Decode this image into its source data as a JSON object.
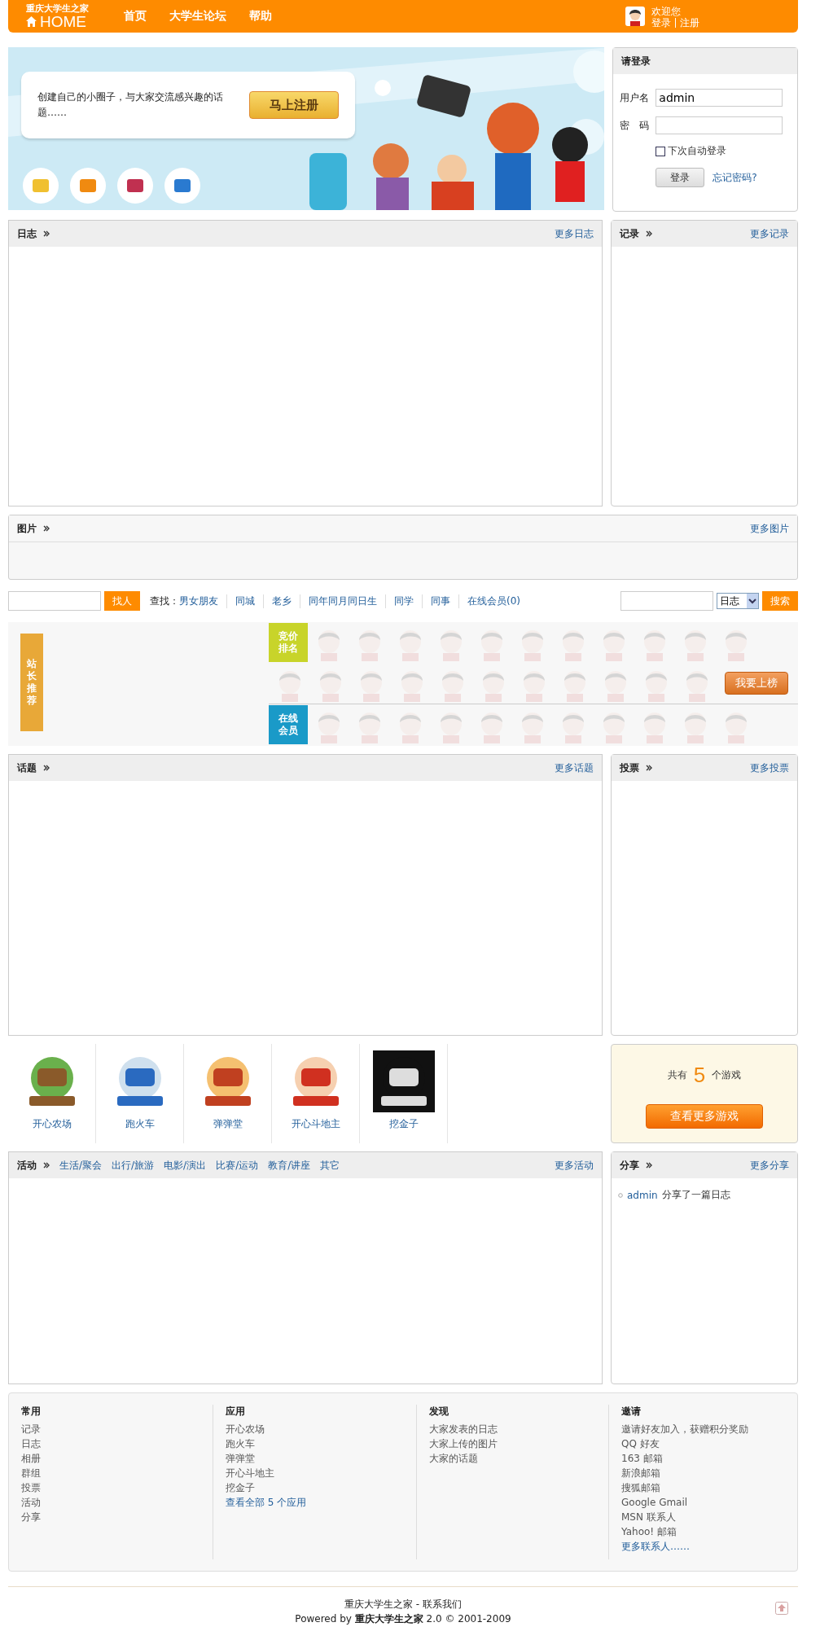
{
  "header": {
    "site_name": "重庆大学生之家",
    "home_label": "HOME",
    "nav": [
      "首页",
      "大学生论坛",
      "帮助"
    ],
    "greeting": "欢迎您",
    "user_links": [
      "登录",
      "注册"
    ]
  },
  "banner": {
    "text": "创建自己的小圈子，与大家交流感兴趣的话题……",
    "button": "马上注册"
  },
  "login": {
    "title": "请登录",
    "username_label": "用户名",
    "username_value": "admin",
    "password_label": "密　码",
    "remember_label": "下次自动登录",
    "remember_checked": false,
    "submit": "登录",
    "forgot": "忘记密码?"
  },
  "blog_panel": {
    "title": "日志",
    "more": "更多日志"
  },
  "record_panel": {
    "title": "记录",
    "more": "更多记录"
  },
  "photo_panel": {
    "title": "图片",
    "more": "更多图片"
  },
  "people_search": {
    "button": "找人",
    "find_label": "查找：",
    "links": [
      "男女朋友",
      "同城",
      "老乡",
      "同年同月同日生",
      "同学",
      "同事",
      "在线会员(0)"
    ]
  },
  "site_search": {
    "select": "日志",
    "button": "搜索"
  },
  "members": {
    "recommend_label": "站长推荐",
    "bid_label": "竞价排名",
    "online_label": "在线会员",
    "cta": "我要上榜"
  },
  "topic_panel": {
    "title": "话题",
    "more": "更多话题"
  },
  "poll_panel": {
    "title": "投票",
    "more": "更多投票"
  },
  "games": [
    {
      "name": "开心农场"
    },
    {
      "name": "跑火车"
    },
    {
      "name": "弹弹堂"
    },
    {
      "name": "开心斗地主"
    },
    {
      "name": "挖金子"
    }
  ],
  "game_summary": {
    "prefix": "共有",
    "count": "5",
    "suffix": "个游戏",
    "button": "查看更多游戏"
  },
  "activity_panel": {
    "title": "活动",
    "categories": [
      "生活/聚会",
      "出行/旅游",
      "电影/演出",
      "比赛/运动",
      "教育/讲座",
      "其它"
    ],
    "more": "更多活动"
  },
  "share_panel": {
    "title": "分享",
    "more": "更多分享",
    "items": [
      {
        "user": "admin",
        "text": "分享了一篇日志"
      }
    ]
  },
  "footer_columns": [
    {
      "title": "常用",
      "links": [
        {
          "label": "记录",
          "kind": "plain"
        },
        {
          "label": "日志",
          "kind": "plain"
        },
        {
          "label": "相册",
          "kind": "plain"
        },
        {
          "label": "群组",
          "kind": "plain"
        },
        {
          "label": "投票",
          "kind": "plain"
        },
        {
          "label": "活动",
          "kind": "plain"
        },
        {
          "label": "分享",
          "kind": "plain"
        }
      ]
    },
    {
      "title": "应用",
      "links": [
        {
          "label": "开心农场",
          "kind": "plain"
        },
        {
          "label": "跑火车",
          "kind": "plain"
        },
        {
          "label": "弹弹堂",
          "kind": "plain"
        },
        {
          "label": "开心斗地主",
          "kind": "plain"
        },
        {
          "label": "挖金子",
          "kind": "plain"
        },
        {
          "label": "查看全部  5 个应用",
          "kind": "link"
        }
      ]
    },
    {
      "title": "发现",
      "links": [
        {
          "label": "大家发表的日志",
          "kind": "plain"
        },
        {
          "label": "大家上传的图片",
          "kind": "plain"
        },
        {
          "label": "大家的话题",
          "kind": "plain"
        }
      ]
    },
    {
      "title": "邀请",
      "links": [
        {
          "label": "邀请好友加入，获赠积分奖励",
          "kind": "plain"
        },
        {
          "label": "QQ 好友",
          "kind": "plain"
        },
        {
          "label": "163 邮箱",
          "kind": "plain"
        },
        {
          "label": "新浪邮箱",
          "kind": "plain"
        },
        {
          "label": "搜狐邮箱",
          "kind": "plain"
        },
        {
          "label": "Google Gmail",
          "kind": "plain"
        },
        {
          "label": "MSN 联系人",
          "kind": "plain"
        },
        {
          "label": "Yahoo! 邮箱",
          "kind": "plain"
        },
        {
          "label": "更多联系人……",
          "kind": "link"
        }
      ]
    }
  ],
  "bottom": {
    "line1": "重庆大学生之家  - 联系我们",
    "line2": "Powered by **重庆大学生之家**  2.0 © 2001-2009"
  }
}
